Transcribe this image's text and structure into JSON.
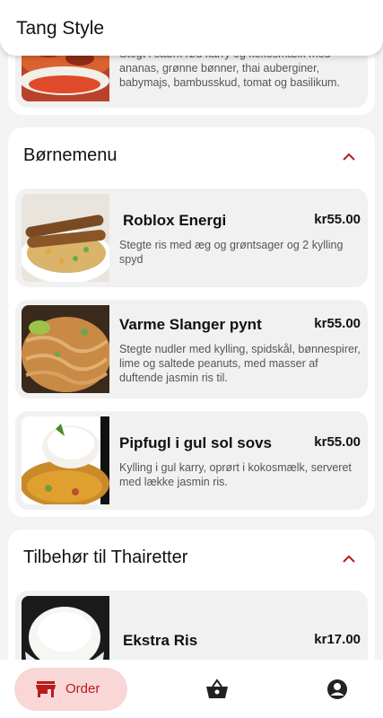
{
  "app": {
    "title": "Tang Style"
  },
  "top_item": {
    "desc": "Stegt i stærk rød karry og kokosmælk med ananas, grønne bønner, thai auberginer, babymajs, bambusskud, tomat og basilikum."
  },
  "sections": [
    {
      "title": "Børnemenu",
      "items": [
        {
          "name": "Roblox Energi",
          "price": "kr55.00",
          "desc": "Stegte ris med æg og grøntsager og 2 kylling spyd"
        },
        {
          "name": "Varme Slanger pynt",
          "price": "kr55.00",
          "desc": "Stegte nudler med kylling, spidskål, bønnespirer, lime og saltede peanuts, med masser af duftende jasmin ris til."
        },
        {
          "name": "Pipfugl i gul sol sovs",
          "price": "kr55.00",
          "desc": "Kylling i gul karry, oprørt i kokosmælk, serveret med lække jasmin ris."
        }
      ]
    },
    {
      "title": "Tilbehør til Thairetter",
      "items": [
        {
          "name": "Ekstra Ris",
          "price": "kr17.00",
          "desc": ""
        }
      ]
    }
  ],
  "bottom_nav": {
    "order_label": "Order"
  },
  "colors": {
    "accent": "#b71c1c",
    "order_bg": "#f9d7d7"
  },
  "icons": [
    "chevron-up-icon",
    "store-icon",
    "basket-icon",
    "account-icon"
  ]
}
